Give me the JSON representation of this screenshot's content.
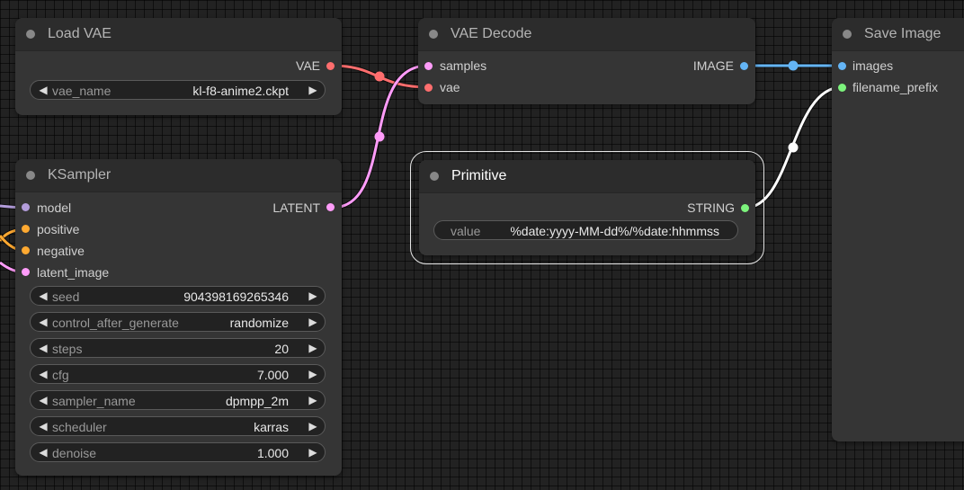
{
  "colors": {
    "vae": "#ff6e6e",
    "latent": "#ff9cf9",
    "image": "#64b5f6",
    "string": "#7cf37c",
    "model": "#b39ddb",
    "conditioning": "#ffa931",
    "link_white": "#ffffff"
  },
  "nodes": {
    "load_vae": {
      "title": "Load VAE",
      "outputs": [
        {
          "label": "VAE",
          "type": "vae"
        }
      ],
      "widgets": [
        {
          "name": "vae_name",
          "value": "kl-f8-anime2.ckpt"
        }
      ]
    },
    "vae_decode": {
      "title": "VAE Decode",
      "inputs": [
        {
          "label": "samples",
          "type": "latent"
        },
        {
          "label": "vae",
          "type": "vae"
        }
      ],
      "outputs": [
        {
          "label": "IMAGE",
          "type": "image"
        }
      ]
    },
    "save_image": {
      "title": "Save Image",
      "inputs": [
        {
          "label": "images",
          "type": "image"
        },
        {
          "label": "filename_prefix",
          "type": "string"
        }
      ]
    },
    "ksampler": {
      "title": "KSampler",
      "inputs": [
        {
          "label": "model",
          "type": "model"
        },
        {
          "label": "positive",
          "type": "conditioning"
        },
        {
          "label": "negative",
          "type": "conditioning"
        },
        {
          "label": "latent_image",
          "type": "latent"
        }
      ],
      "outputs": [
        {
          "label": "LATENT",
          "type": "latent"
        }
      ],
      "widgets": [
        {
          "name": "seed",
          "value": "904398169265346"
        },
        {
          "name": "control_after_generate",
          "value": "randomize"
        },
        {
          "name": "steps",
          "value": "20"
        },
        {
          "name": "cfg",
          "value": "7.000"
        },
        {
          "name": "sampler_name",
          "value": "dpmpp_2m"
        },
        {
          "name": "scheduler",
          "value": "karras"
        },
        {
          "name": "denoise",
          "value": "1.000"
        }
      ]
    },
    "primitive": {
      "title": "Primitive",
      "outputs": [
        {
          "label": "STRING",
          "type": "string"
        }
      ],
      "widgets": [
        {
          "name": "value",
          "value": "%date:yyyy-MM-dd%/%date:hhmmss"
        }
      ]
    }
  }
}
